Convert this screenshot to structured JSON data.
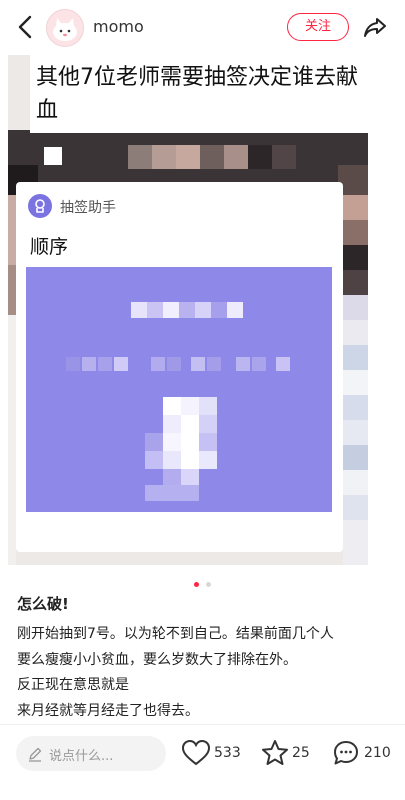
{
  "header": {
    "username": "momo",
    "follow_label": "关注"
  },
  "post_image": {
    "caption_line1": "其他7位老师需要抽签决定谁去献",
    "caption_line2": "血",
    "card_app_name": "抽签助手",
    "card_title": "顺序",
    "panel_color": "#8e88e9"
  },
  "carousel": {
    "total": 2,
    "active_index": 1
  },
  "post": {
    "title": "怎么破!",
    "lines": [
      "刚开始抽到7号。以为轮不到自己。结果前面几个人",
      "要么瘦瘦小小贫血，要么岁数大了排除在外。",
      "反正现在意思就是",
      "来月经就等月经走了也得去。"
    ]
  },
  "bottom_bar": {
    "comment_placeholder": "说点什么...",
    "likes": "533",
    "favorites": "25",
    "comments": "210"
  },
  "colors": {
    "accent": "#ff2442",
    "purple": "#8e88e9"
  }
}
